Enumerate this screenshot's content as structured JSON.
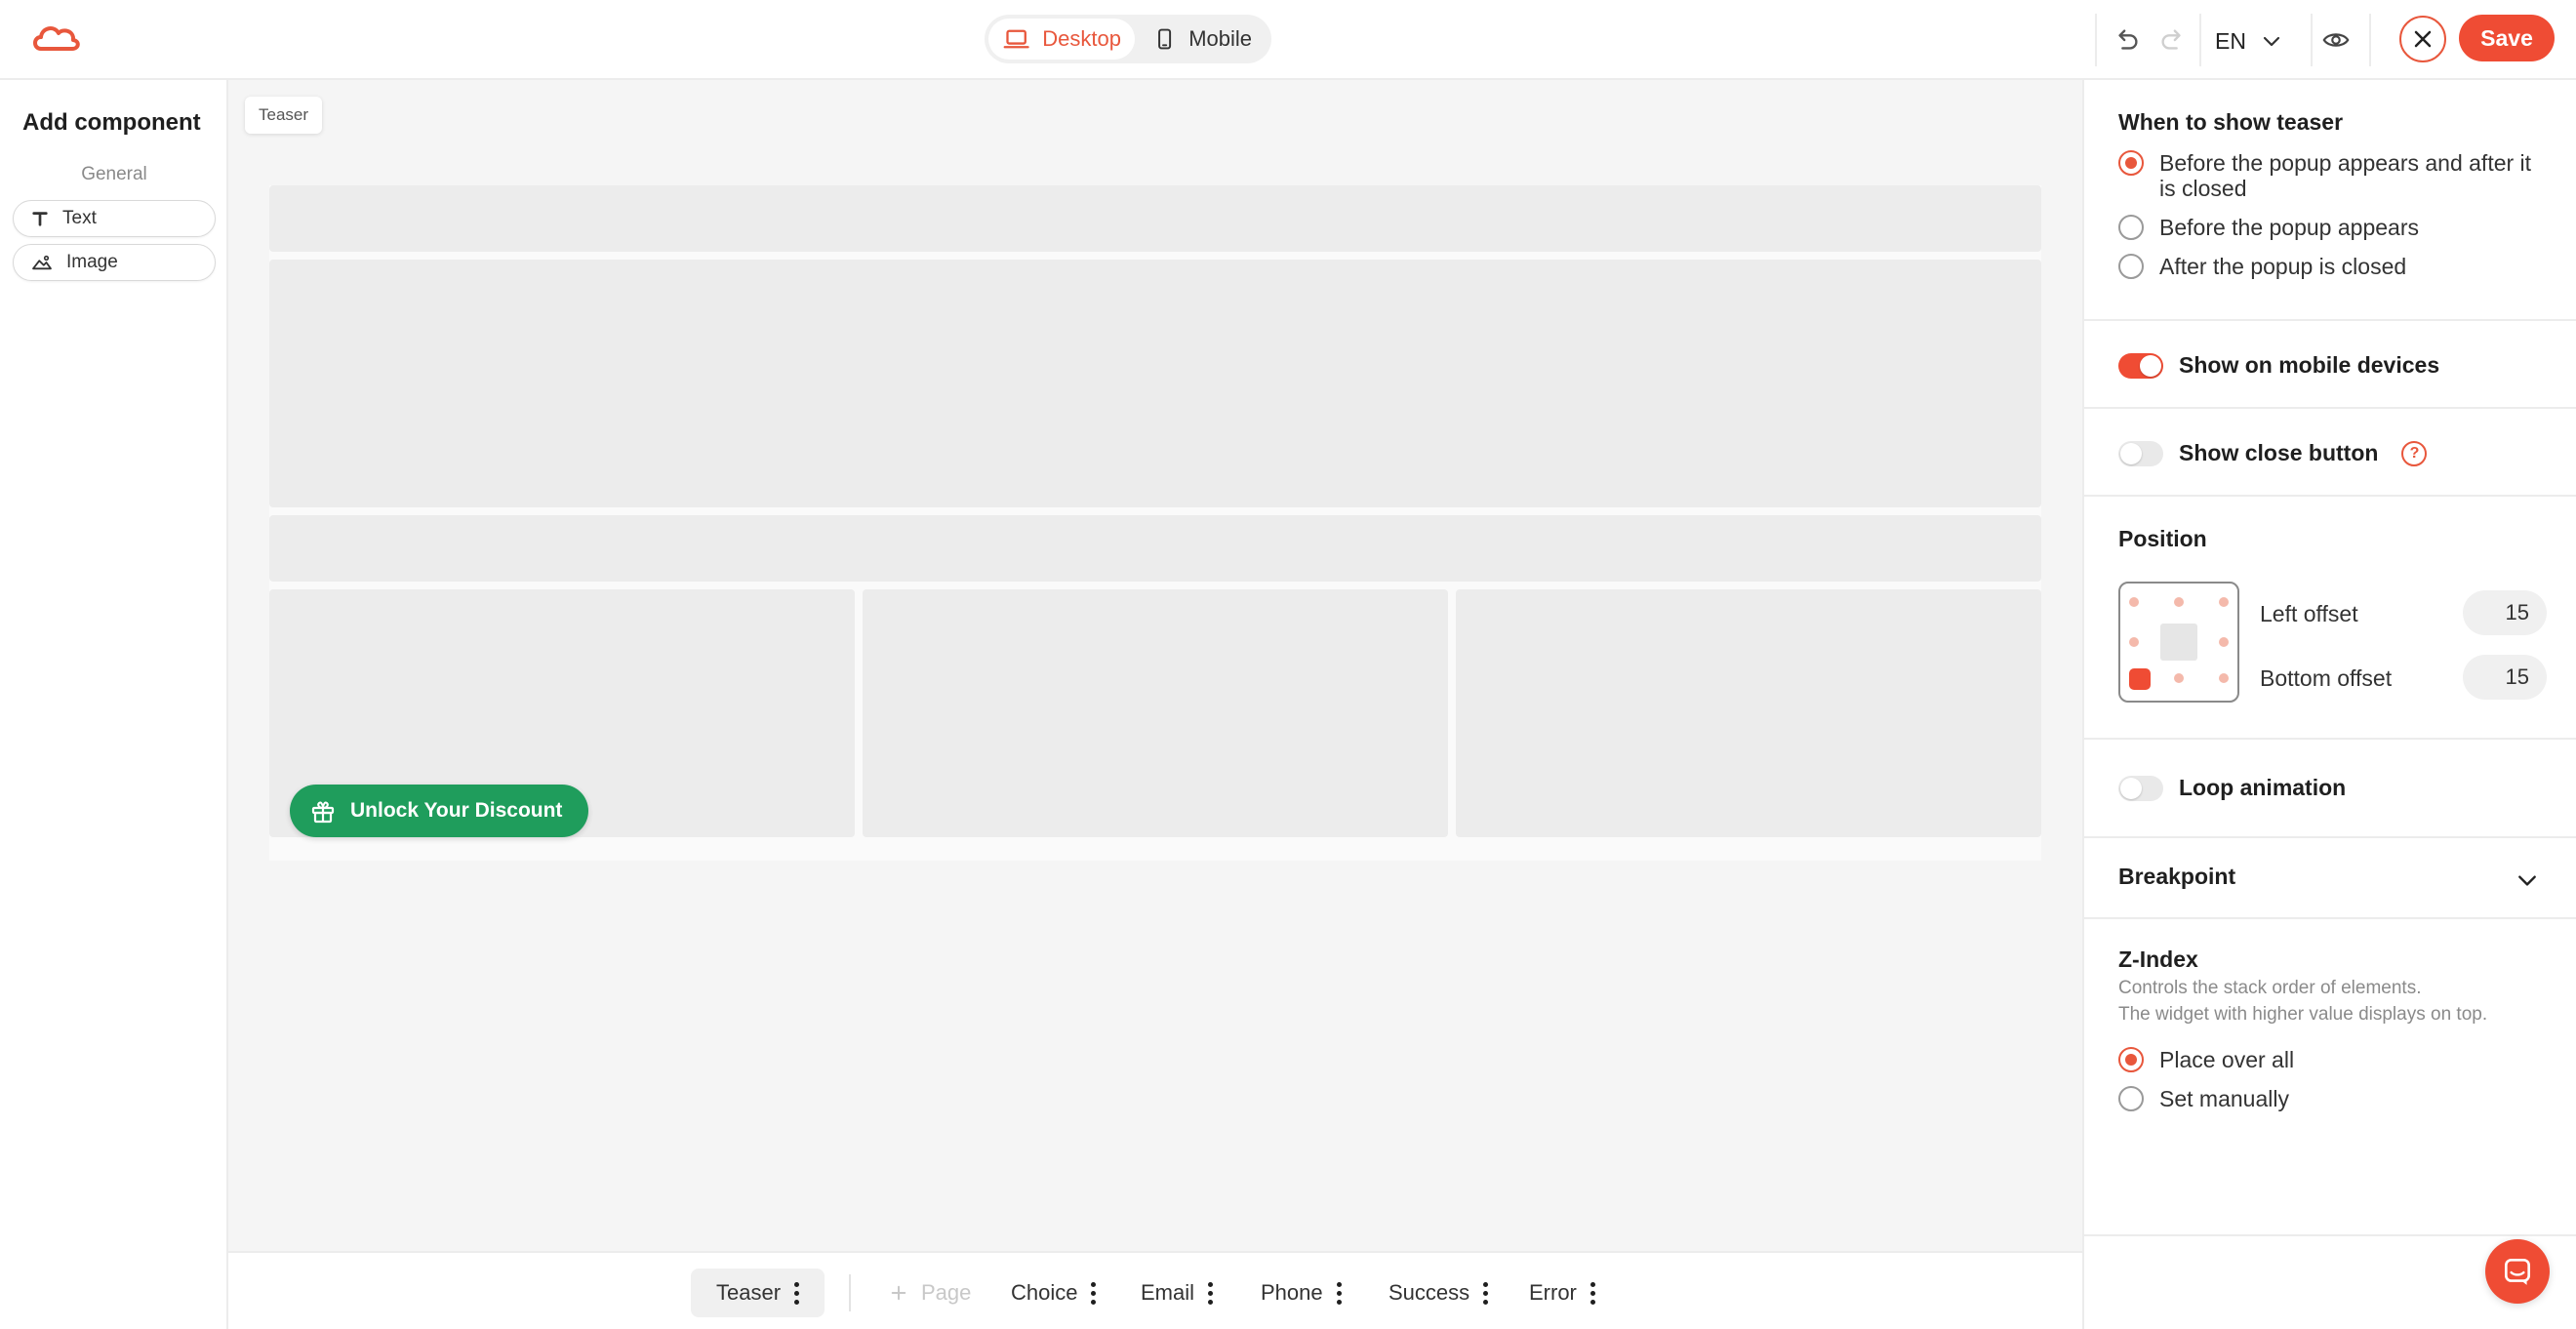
{
  "topbar": {
    "device_desktop": "Desktop",
    "device_mobile": "Mobile",
    "language": "EN",
    "save_label": "Save",
    "accent": "#ef4c34"
  },
  "left_panel": {
    "title": "Add component",
    "section": "General",
    "components": [
      {
        "label": "Text",
        "icon": "text-icon"
      },
      {
        "label": "Image",
        "icon": "image-icon"
      }
    ]
  },
  "canvas": {
    "tag": "Teaser",
    "teaser_button": "Unlock Your Discount",
    "teaser_color": "#1f9d5c"
  },
  "bottom_bar": {
    "tabs": [
      {
        "label": "Teaser",
        "active": true
      },
      {
        "label": "Page",
        "disabled": true
      },
      {
        "label": "Choice"
      },
      {
        "label": "Email"
      },
      {
        "label": "Phone"
      },
      {
        "label": "Success"
      },
      {
        "label": "Error"
      }
    ]
  },
  "right_panel": {
    "when_to_show": {
      "title": "When to show teaser",
      "options": [
        {
          "label": "Before the popup appears and after it is closed",
          "selected": true
        },
        {
          "label": "Before the popup appears",
          "selected": false
        },
        {
          "label": "After the popup is closed",
          "selected": false
        }
      ]
    },
    "show_on_mobile": {
      "label": "Show on mobile devices",
      "on": true
    },
    "show_close_button": {
      "label": "Show close button",
      "on": false,
      "help": "?"
    },
    "position": {
      "title": "Position",
      "selected": "bottom-left",
      "left_offset_label": "Left offset",
      "left_offset_value": "15",
      "bottom_offset_label": "Bottom offset",
      "bottom_offset_value": "15"
    },
    "loop_animation": {
      "label": "Loop animation",
      "on": false
    },
    "breakpoint": {
      "label": "Breakpoint"
    },
    "z_index": {
      "title": "Z-Index",
      "desc_line1": "Controls the stack order of elements.",
      "desc_line2": "The widget with higher value displays on top.",
      "options": [
        {
          "label": "Place over all",
          "selected": true
        },
        {
          "label": "Set manually",
          "selected": false
        }
      ]
    }
  }
}
